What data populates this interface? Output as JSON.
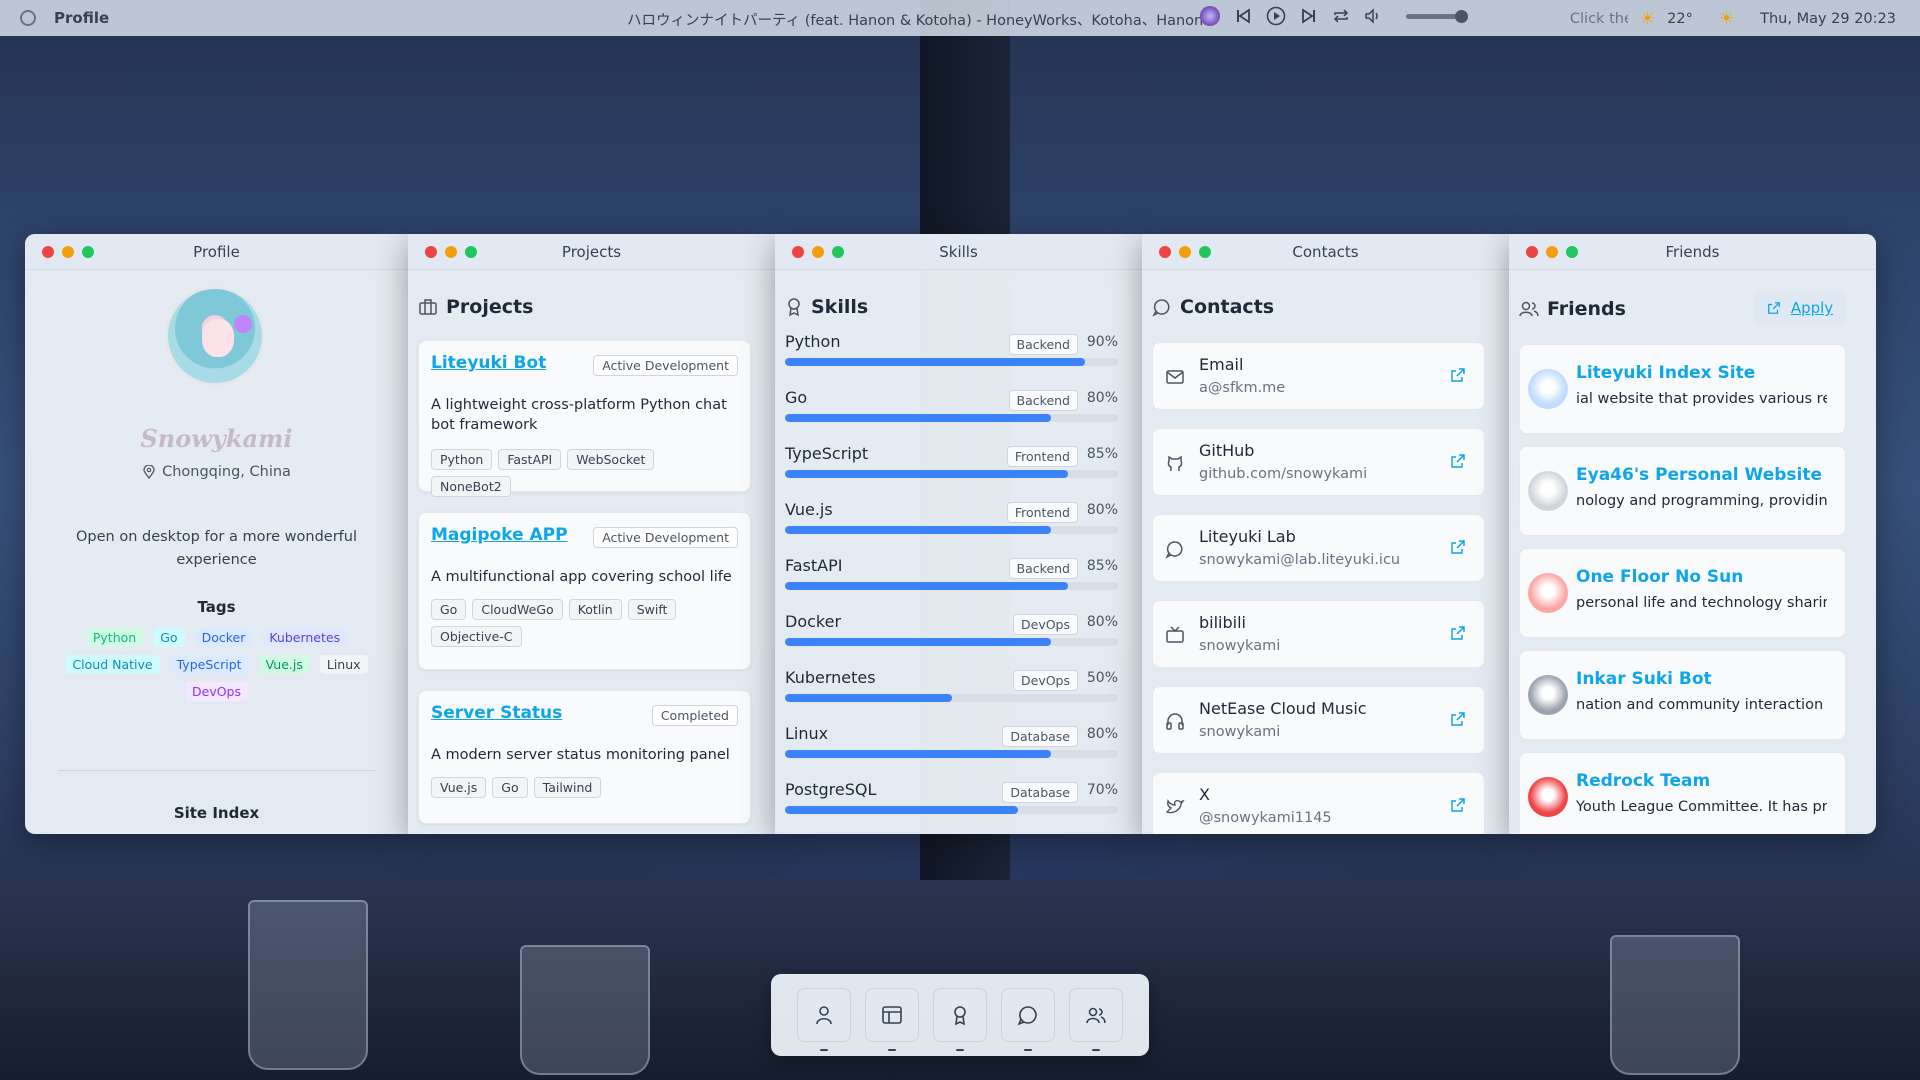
{
  "topbar": {
    "app_name": "Profile",
    "song": "ハロウィンナイトパーティ (feat. Hanon & Kotoha) - HoneyWorks、Kotoha、Hanon",
    "click_hint": "Click the",
    "temperature": "22°",
    "datetime": "Thu, May 29  20:23"
  },
  "windows": {
    "profile": {
      "title": "Profile",
      "name": "Snowykami",
      "location": "Chongqing, China",
      "note": "Open on desktop for a more wonderful experience",
      "tags_title": "Tags",
      "tags": [
        {
          "label": "Python",
          "color": "#10b981",
          "bg": "#d1fae5"
        },
        {
          "label": "Go",
          "color": "#0891b2",
          "bg": "#cffafe"
        },
        {
          "label": "Docker",
          "color": "#2563eb",
          "bg": "#dbeafe"
        },
        {
          "label": "Kubernetes",
          "color": "#4f46e5",
          "bg": "#e0e7ff"
        },
        {
          "label": "Cloud Native",
          "color": "#0891b2",
          "bg": "#cffafe"
        },
        {
          "label": "TypeScript",
          "color": "#2563eb",
          "bg": "#dbeafe"
        },
        {
          "label": "Vue.js",
          "color": "#059669",
          "bg": "#d1fae5"
        },
        {
          "label": "Linux",
          "color": "#374151",
          "bg": "#f3f4f6"
        },
        {
          "label": "DevOps",
          "color": "#9333ea",
          "bg": "#f3e8ff"
        }
      ],
      "site_index_title": "Site Index"
    },
    "projects": {
      "title": "Projects",
      "heading": "Projects",
      "items": [
        {
          "name": "Liteyuki Bot",
          "status": "Active Development",
          "desc": "A lightweight cross-platform Python chat bot framework",
          "tags": [
            "Python",
            "FastAPI",
            "WebSocket",
            "NoneBot2"
          ]
        },
        {
          "name": "Magipoke APP",
          "status": "Active Development",
          "desc": "A multifunctional app covering school life",
          "tags": [
            "Go",
            "CloudWeGo",
            "Kotlin",
            "Swift",
            "Objective-C"
          ]
        },
        {
          "name": "Server Status",
          "status": "Completed",
          "desc": "A modern server status monitoring panel",
          "tags": [
            "Vue.js",
            "Go",
            "Tailwind"
          ]
        }
      ]
    },
    "skills": {
      "title": "Skills",
      "heading": "Skills",
      "items": [
        {
          "name": "Python",
          "category": "Backend",
          "level": 90,
          "level_text": "90%"
        },
        {
          "name": "Go",
          "category": "Backend",
          "level": 80,
          "level_text": "80%"
        },
        {
          "name": "TypeScript",
          "category": "Frontend",
          "level": 85,
          "level_text": "85%"
        },
        {
          "name": "Vue.js",
          "category": "Frontend",
          "level": 80,
          "level_text": "80%"
        },
        {
          "name": "FastAPI",
          "category": "Backend",
          "level": 85,
          "level_text": "85%"
        },
        {
          "name": "Docker",
          "category": "DevOps",
          "level": 80,
          "level_text": "80%"
        },
        {
          "name": "Kubernetes",
          "category": "DevOps",
          "level": 50,
          "level_text": "50%"
        },
        {
          "name": "Linux",
          "category": "Database",
          "level": 80,
          "level_text": "80%"
        },
        {
          "name": "PostgreSQL",
          "category": "Database",
          "level": 70,
          "level_text": "70%"
        }
      ]
    },
    "contacts": {
      "title": "Contacts",
      "heading": "Contacts",
      "items": [
        {
          "label": "Email",
          "value": "a@sfkm.me",
          "icon": "mail-icon"
        },
        {
          "label": "GitHub",
          "value": "github.com/snowykami",
          "icon": "github-icon"
        },
        {
          "label": "Liteyuki Lab",
          "value": "snowykami@lab.liteyuki.icu",
          "icon": "chat-icon"
        },
        {
          "label": "bilibili",
          "value": "snowykami",
          "icon": "tv-icon"
        },
        {
          "label": "NetEase Cloud Music",
          "value": "snowykami",
          "icon": "headphones-icon"
        },
        {
          "label": "X",
          "value": "@snowykami1145",
          "icon": "bird-icon"
        }
      ]
    },
    "friends": {
      "title": "Friends",
      "heading": "Friends",
      "apply_label": "Apply",
      "items": [
        {
          "name": "Liteyuki Index Site",
          "desc": "ial website that provides various res",
          "color": "#bfdbfe"
        },
        {
          "name": "Eya46's Personal Website",
          "desc": "nology and programming, providing",
          "color": "#d1d5db"
        },
        {
          "name": "One Floor No Sun",
          "desc": "personal life and technology sharing",
          "color": "#fca5a5"
        },
        {
          "name": "Inkar Suki Bot",
          "desc": "nation and community interaction fe",
          "color": "#9ca3af"
        },
        {
          "name": "Redrock Team",
          "desc": "Youth League Committee. It has pro",
          "color": "#ef4444"
        }
      ]
    }
  },
  "dock": [
    "profile-dock-icon",
    "projects-dock-icon",
    "skills-dock-icon",
    "contacts-dock-icon",
    "friends-dock-icon"
  ],
  "colors": {
    "accent": "#0ea5e9",
    "bar": "#3b82f6"
  }
}
